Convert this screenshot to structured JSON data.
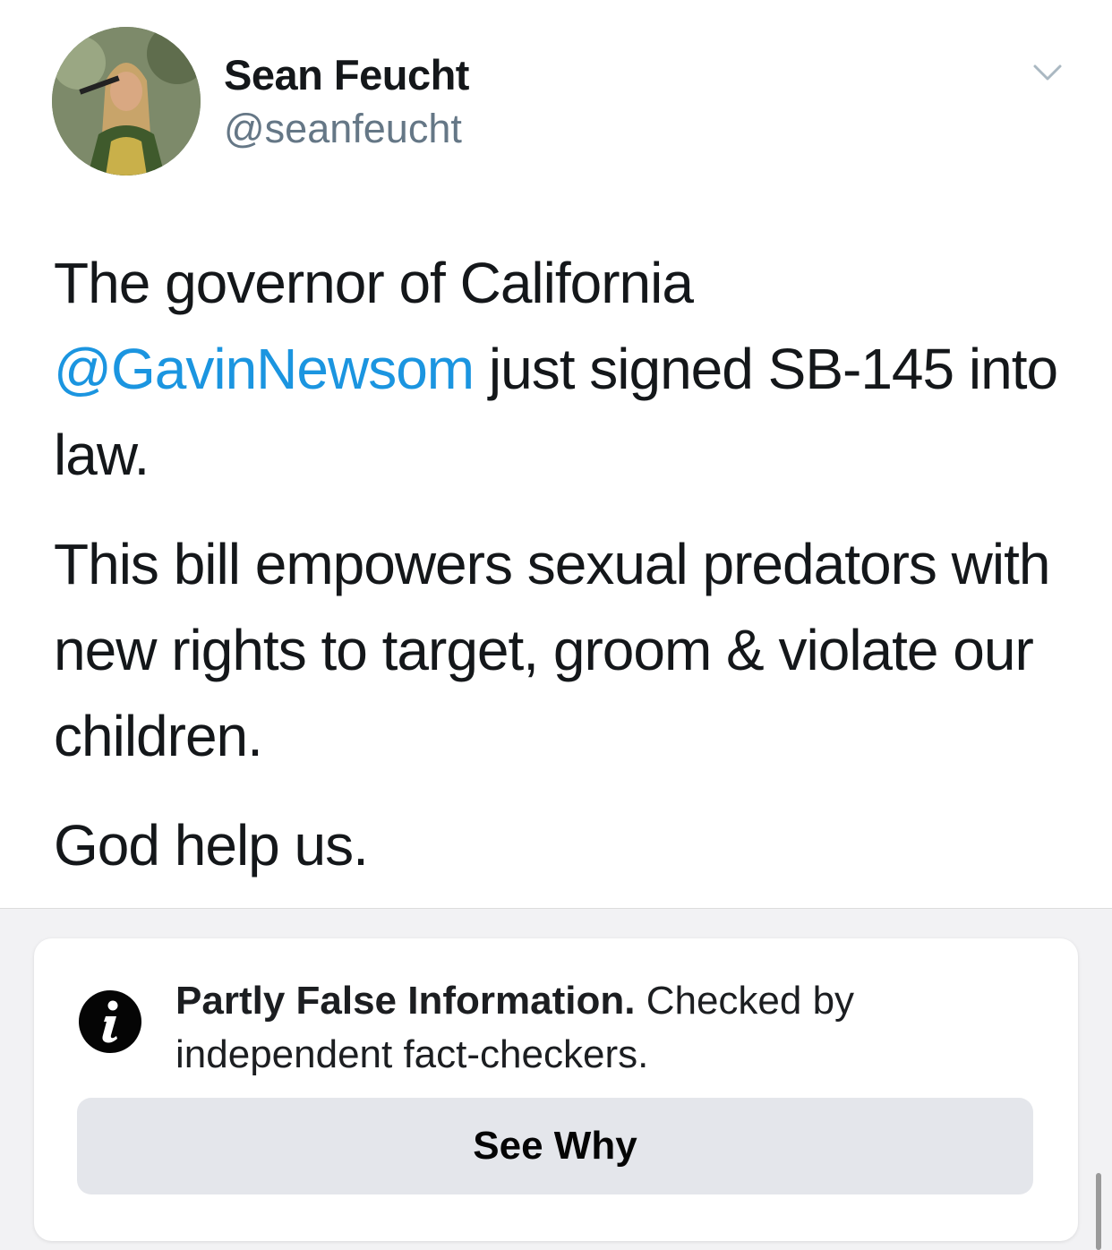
{
  "tweet": {
    "display_name": "Sean Feucht",
    "handle": "@seanfeucht",
    "paragraphs": [
      {
        "lead": "The governor of California",
        "mention": "@GavinNewsom",
        "tail": " just signed SB-145 into law."
      },
      {
        "text": "This bill empowers sexual predators with new rights to target, groom & violate our children."
      },
      {
        "text": "God help us."
      }
    ],
    "menu_icon": "chevron-down-icon"
  },
  "fact_check": {
    "icon": "info-icon",
    "rating": "Partly False Information.",
    "detail": " Checked by independent fact-checkers.",
    "button_label": "See Why"
  },
  "colors": {
    "mention": "#1b95e0",
    "handle": "#657786",
    "button_bg": "#e4e6eb"
  }
}
